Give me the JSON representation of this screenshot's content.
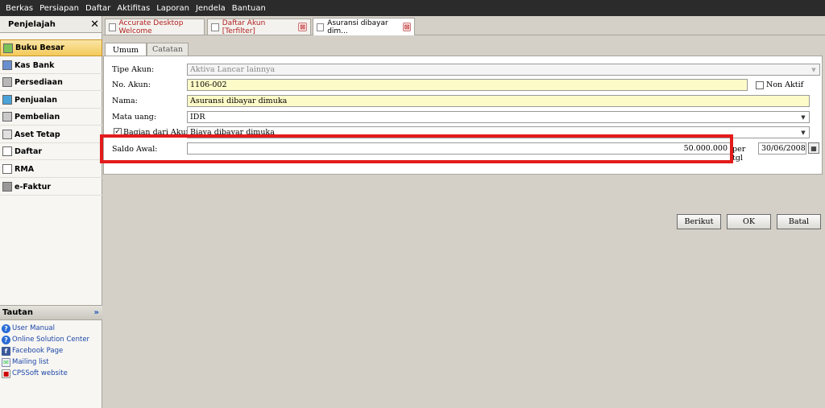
{
  "menubar": {
    "items": [
      "Berkas",
      "Persiapan",
      "Daftar",
      "Aktifitas",
      "Laporan",
      "Jendela",
      "Bantuan"
    ]
  },
  "sidebar": {
    "title": "Penjelajah",
    "close": "✕",
    "items": [
      {
        "label": "Buku Besar",
        "icon": "ledger-icon"
      },
      {
        "label": "Kas Bank",
        "icon": "bank-icon"
      },
      {
        "label": "Persediaan",
        "icon": "inventory-icon"
      },
      {
        "label": "Penjualan",
        "icon": "sales-icon"
      },
      {
        "label": "Pembelian",
        "icon": "cart-icon"
      },
      {
        "label": "Aset Tetap",
        "icon": "house-icon"
      },
      {
        "label": "Daftar",
        "icon": "list-icon"
      },
      {
        "label": "RMA",
        "icon": "rma-icon"
      },
      {
        "label": "e-Faktur",
        "icon": "efaktur-icon"
      }
    ],
    "tautan": {
      "title": "Tautan",
      "collapse": "»",
      "links": [
        {
          "label": "User Manual",
          "icon": "help-icon",
          "glyph": "?"
        },
        {
          "label": "Online Solution Center",
          "icon": "help-icon",
          "glyph": "?"
        },
        {
          "label": "Facebook Page",
          "icon": "facebook-icon",
          "glyph": "f"
        },
        {
          "label": "Mailing list",
          "icon": "mail-icon",
          "glyph": "✉"
        },
        {
          "label": "CPSSoft website",
          "icon": "web-icon",
          "glyph": "■"
        }
      ]
    }
  },
  "doc_tabs": [
    {
      "label": "Accurate Desktop Welcome",
      "close": "⊠"
    },
    {
      "label": "Daftar Akun [Terfilter]",
      "close": "⊠"
    },
    {
      "label": "Asuransi dibayar dim...",
      "close": "⊠"
    }
  ],
  "form": {
    "tabs": [
      "Umum",
      "Catatan"
    ],
    "tipe_akun": {
      "label": "Tipe Akun:",
      "value": "Aktiva Lancar lainnya"
    },
    "no_akun": {
      "label": "No. Akun:",
      "value": "1106-002"
    },
    "non_aktif": {
      "label": "Non Aktif",
      "checked": false
    },
    "nama": {
      "label": "Nama:",
      "value": "Asuransi dibayar dimuka"
    },
    "mata_uang": {
      "label": "Mata uang:",
      "value": "IDR"
    },
    "bagian": {
      "label": "Bagian dari Akun",
      "checked": true,
      "value": "Biaya dibayar dimuka"
    },
    "saldo_awal": {
      "label": "Saldo Awal:",
      "value": "50.000.000"
    },
    "per_tgl": {
      "label": "per tgl",
      "value": "30/06/2008"
    },
    "buttons": {
      "berikut": "Berikut",
      "ok": "OK",
      "batal": "Batal"
    }
  },
  "colors": {
    "highlight": "#e31b1b",
    "field_yellow": "#fdfbc8",
    "nav_selected": "#f3c95a"
  }
}
